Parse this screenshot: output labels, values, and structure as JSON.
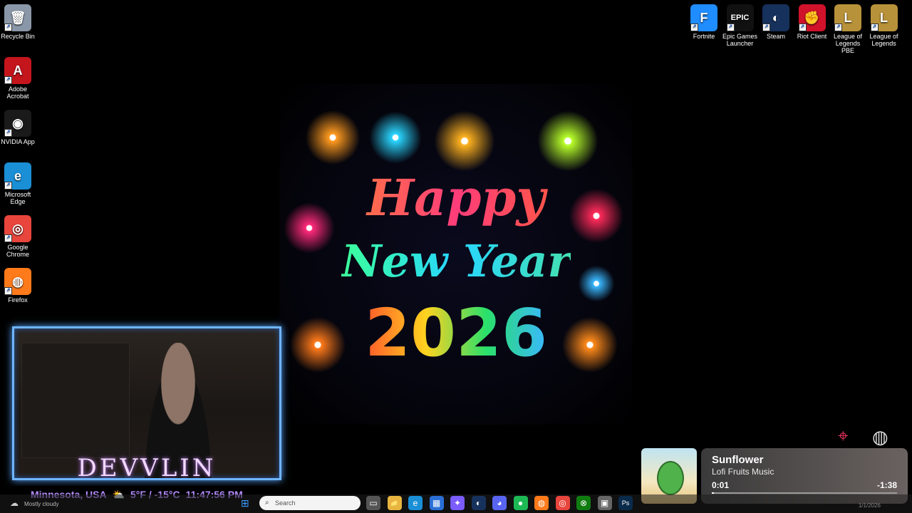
{
  "desktop_left": [
    {
      "label": "Recycle Bin",
      "icon": "recycle-bin-icon",
      "color": "#8a97a8",
      "glyph": "🗑"
    },
    {
      "label": "Adobe Acrobat",
      "icon": "adobe-acrobat-icon",
      "color": "#c4151c",
      "glyph": "A"
    },
    {
      "label": "NVIDIA App",
      "icon": "nvidia-app-icon",
      "color": "#1a1a1a",
      "glyph": "◉"
    },
    {
      "label": "Microsoft Edge",
      "icon": "edge-icon",
      "color": "#1a8fd6",
      "glyph": "e"
    },
    {
      "label": "Google Chrome",
      "icon": "chrome-icon",
      "color": "#e8453c",
      "glyph": "◎"
    },
    {
      "label": "Firefox",
      "icon": "firefox-icon",
      "color": "#ff7a1a",
      "glyph": "◍"
    }
  ],
  "desktop_right": [
    {
      "label": "Fortnite",
      "icon": "fortnite-icon",
      "color": "#1f8cff",
      "glyph": "F"
    },
    {
      "label": "Epic Games Launcher",
      "icon": "epic-games-icon",
      "color": "#111111",
      "glyph": "EPIC"
    },
    {
      "label": "Steam",
      "icon": "steam-icon",
      "color": "#16325c",
      "glyph": "◐"
    },
    {
      "label": "Riot Client",
      "icon": "riot-client-icon",
      "color": "#d0122a",
      "glyph": "✊"
    },
    {
      "label": "League of Legends PBE",
      "icon": "league-pbe-icon",
      "color": "#b8923a",
      "glyph": "L"
    },
    {
      "label": "League of Legends",
      "icon": "league-icon",
      "color": "#b8923a",
      "glyph": "L"
    }
  ],
  "wallpaper": {
    "line1": "Happy",
    "line2": "New Year",
    "line3": "2026"
  },
  "webcam": {
    "name": "DEVVLIN",
    "location": "Minnesota, USA",
    "temperature": "5°F / -15°C",
    "time": "11:47:56 PM"
  },
  "media": {
    "title": "Sunflower",
    "artist": "Lofi Fruits Music",
    "elapsed": "0:01",
    "remaining": "-1:38",
    "progress": 0.01
  },
  "taskbar": {
    "weather": "Mostly cloudy",
    "search_placeholder": "Search",
    "date": "1/1/2026",
    "pinned": [
      {
        "name": "task-view-icon",
        "glyph": "▭",
        "color": "#555"
      },
      {
        "name": "file-explorer-icon",
        "glyph": "📁",
        "color": "#e8b540"
      },
      {
        "name": "edge-taskbar-icon",
        "glyph": "e",
        "color": "#1a8fd6"
      },
      {
        "name": "store-icon",
        "glyph": "▦",
        "color": "#2a6fd6"
      },
      {
        "name": "copilot-icon",
        "glyph": "✦",
        "color": "#7a5cff"
      },
      {
        "name": "steam-taskbar-icon",
        "glyph": "◐",
        "color": "#16325c"
      },
      {
        "name": "discord-icon",
        "glyph": "◕",
        "color": "#5865f2"
      },
      {
        "name": "spotify-icon",
        "glyph": "●",
        "color": "#1db954"
      },
      {
        "name": "firefox-taskbar-icon",
        "glyph": "◍",
        "color": "#ff7a1a"
      },
      {
        "name": "chrome-taskbar-icon",
        "glyph": "◎",
        "color": "#e8453c"
      },
      {
        "name": "xbox-icon",
        "glyph": "⊗",
        "color": "#107c10"
      },
      {
        "name": "app-icon",
        "glyph": "▣",
        "color": "#666"
      },
      {
        "name": "photoshop-icon",
        "glyph": "Ps",
        "color": "#0a2a4a"
      }
    ]
  }
}
